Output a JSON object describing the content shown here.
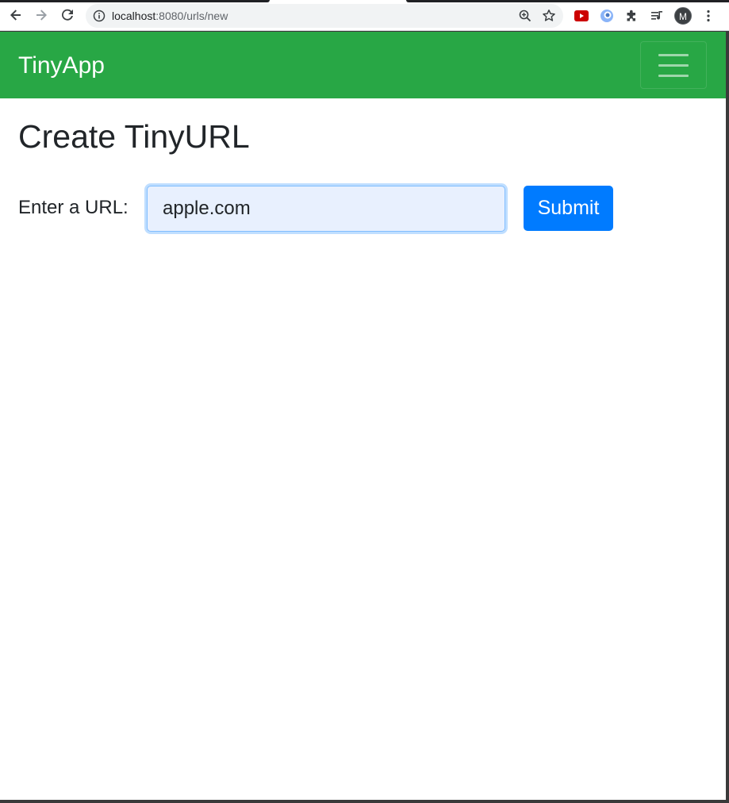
{
  "browser": {
    "url_host": "localhost",
    "url_path": ":8080/urls/new",
    "avatar_letter": "M",
    "icons": {
      "back": "arrow-left-icon",
      "forward": "arrow-right-icon",
      "reload": "reload-icon",
      "site_info": "info-icon",
      "zoom": "zoom-icon",
      "bookmark": "star-icon",
      "ext_youtube": "youtube-extension-icon",
      "ext_other": "extension-badge-icon",
      "extensions": "puzzle-icon",
      "media": "media-control-icon",
      "menu": "more-vert-icon"
    }
  },
  "navbar": {
    "brand": "TinyApp",
    "background": "#28a745",
    "toggler_icon": "hamburger-menu-icon"
  },
  "main": {
    "heading": "Create TinyURL",
    "form": {
      "label": "Enter a URL:",
      "input_value": "apple.com",
      "submit_label": "Submit",
      "submit_color": "#007bff"
    }
  }
}
